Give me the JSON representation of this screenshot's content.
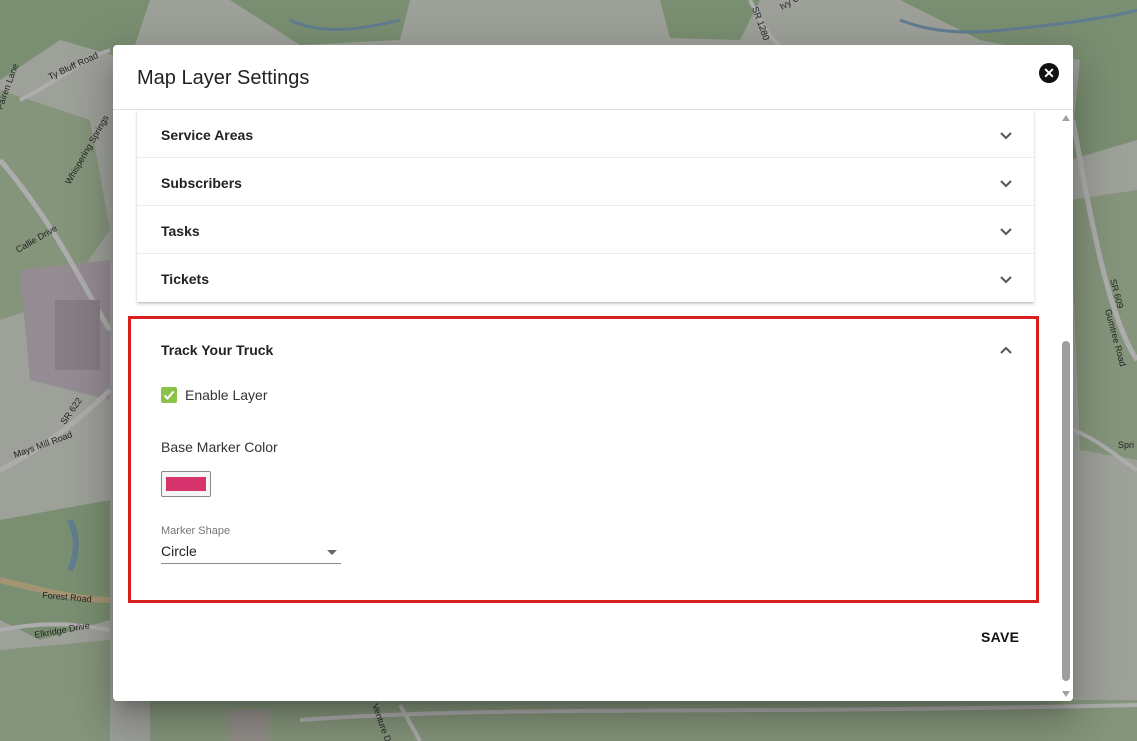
{
  "dialog": {
    "title": "Map Layer Settings",
    "close_icon": "close-circle-icon",
    "panels": [
      {
        "label": "Service Areas",
        "icon": "chevron-down-icon"
      },
      {
        "label": "Subscribers",
        "icon": "chevron-down-icon"
      },
      {
        "label": "Tasks",
        "icon": "chevron-down-icon"
      },
      {
        "label": "Tickets",
        "icon": "chevron-down-icon"
      }
    ],
    "track_panel": {
      "title": "Track Your Truck",
      "icon": "chevron-up-icon",
      "enable_label": "Enable Layer",
      "enable_checked": true,
      "color_label": "Base Marker Color",
      "marker_color": "#d6336c",
      "shape_label": "Marker Shape",
      "shape_value": "Circle"
    },
    "save_label": "SAVE"
  },
  "map": {
    "labels": [
      "Ty Bluff Road",
      "Callie Drive",
      "Mays Mill Road",
      "SR 622",
      "Forest Road",
      "Elkridge Drive",
      "SR 1280",
      "Ivy Creek",
      "SR 609",
      "Gumtree Road",
      "Whispering Springs",
      "Spri",
      "Venture Drive",
      "Fairen Lane"
    ]
  },
  "colors": {
    "accent_red": "#d81f1f",
    "checkbox_green": "#8bc34a"
  }
}
